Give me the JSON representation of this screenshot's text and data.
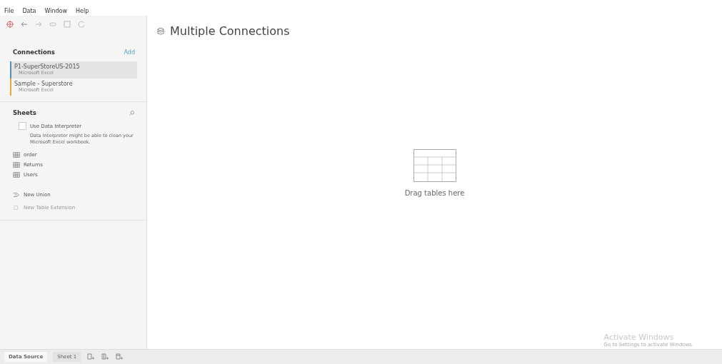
{
  "menu": [
    "File",
    "Data",
    "Window",
    "Help"
  ],
  "connections": {
    "title": "Connections",
    "add": "Add",
    "items": [
      {
        "name": "P1-SuperStoreUS-2015",
        "type": "Microsoft Excel",
        "color": "#4e8fc4",
        "selected": true
      },
      {
        "name": "Sample - Superstore",
        "type": "Microsoft Excel",
        "color": "#f0a53c",
        "selected": false
      }
    ]
  },
  "sheets": {
    "title": "Sheets",
    "interpreter": {
      "label": "Use Data Interpreter",
      "checked": false,
      "note": "Data Interpreter might be able to clean your Microsoft Excel workbook."
    },
    "tables": [
      "order",
      "Returns",
      "Users"
    ],
    "actions": [
      {
        "label": "New Union",
        "disabled": false
      },
      {
        "label": "New Table Extension",
        "disabled": true
      }
    ]
  },
  "canvas": {
    "title": "Multiple Connections",
    "hint": "Drag tables here"
  },
  "bottom_tabs": [
    {
      "label": "Data Source",
      "selected": true
    },
    {
      "label": "Sheet 1",
      "selected": false
    }
  ],
  "watermark": {
    "title": "Activate Windows",
    "subtitle": "Go to Settings to activate Windows."
  }
}
